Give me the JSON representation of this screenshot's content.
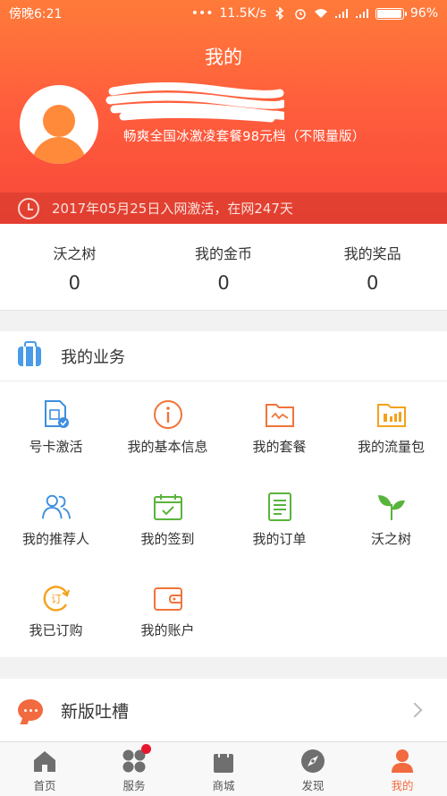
{
  "status_bar": {
    "time": "傍晚6:21",
    "dots": "•••",
    "speed": "11.5K/s",
    "battery": "96%"
  },
  "header": {
    "title": "我的",
    "plan": "畅爽全国冰激凌套餐98元档（不限量版）",
    "activation": "2017年05月25日入网激活，在网247天"
  },
  "stats": [
    {
      "label": "沃之树",
      "value": "0"
    },
    {
      "label": "我的金币",
      "value": "0"
    },
    {
      "label": "我的奖品",
      "value": "0"
    }
  ],
  "business": {
    "title": "我的业务",
    "items": [
      {
        "label": "号卡激活",
        "icon": "sim-card-check-icon"
      },
      {
        "label": "我的基本信息",
        "icon": "info-circle-icon"
      },
      {
        "label": "我的套餐",
        "icon": "package-folder-icon"
      },
      {
        "label": "我的流量包",
        "icon": "data-chart-folder-icon"
      },
      {
        "label": "我的推荐人",
        "icon": "people-icon"
      },
      {
        "label": "我的签到",
        "icon": "calendar-check-icon"
      },
      {
        "label": "我的订单",
        "icon": "order-list-icon"
      },
      {
        "label": "沃之树",
        "icon": "sprout-icon"
      },
      {
        "label": "我已订购",
        "icon": "subscribed-ding-icon"
      },
      {
        "label": "我的账户",
        "icon": "wallet-icon"
      }
    ],
    "order_badge_char": "订"
  },
  "feedback": {
    "label": "新版吐槽"
  },
  "tabbar": [
    {
      "label": "首页",
      "icon": "home-icon"
    },
    {
      "label": "服务",
      "icon": "services-icon"
    },
    {
      "label": "商城",
      "icon": "shop-bag-icon"
    },
    {
      "label": "发现",
      "icon": "compass-icon"
    },
    {
      "label": "我的",
      "icon": "user-icon",
      "active": true
    }
  ],
  "colors": {
    "header_start": "#ff7b3a",
    "header_end": "#f8473a",
    "accent": "#f26a3f",
    "badge": "#e8172d"
  }
}
